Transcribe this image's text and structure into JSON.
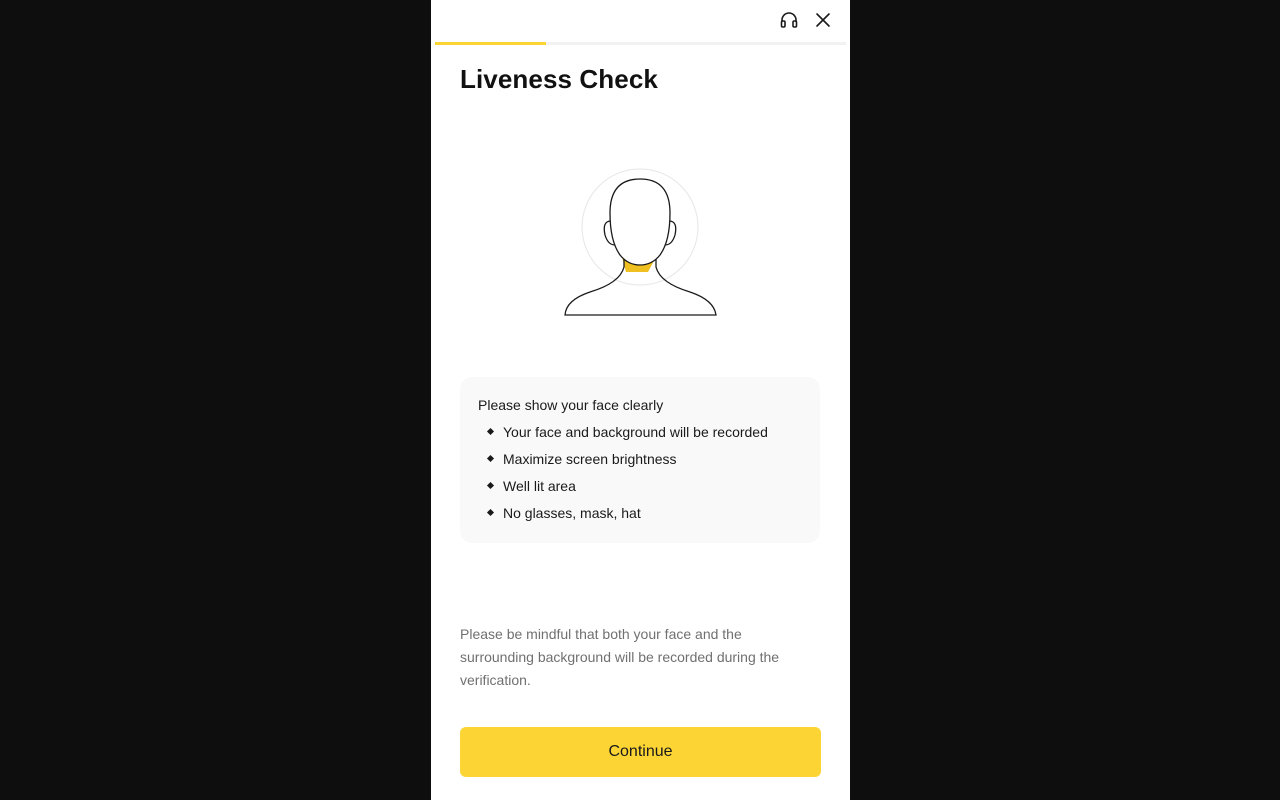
{
  "header": {
    "support_icon": "headset-icon",
    "close_icon": "close-icon",
    "progress": 0.27,
    "accent_color": "#fcd535"
  },
  "page": {
    "title": "Liveness Check"
  },
  "illustration": {
    "icon": "face-outline-icon"
  },
  "tips": {
    "heading": "Please show your face clearly",
    "items": [
      "Your face and background will be recorded",
      "Maximize screen brightness",
      "Well lit area",
      "No glasses, mask, hat"
    ]
  },
  "notice": "Please be mindful that both your face and the surrounding background will be recorded during the verification.",
  "continue_label": "Continue"
}
